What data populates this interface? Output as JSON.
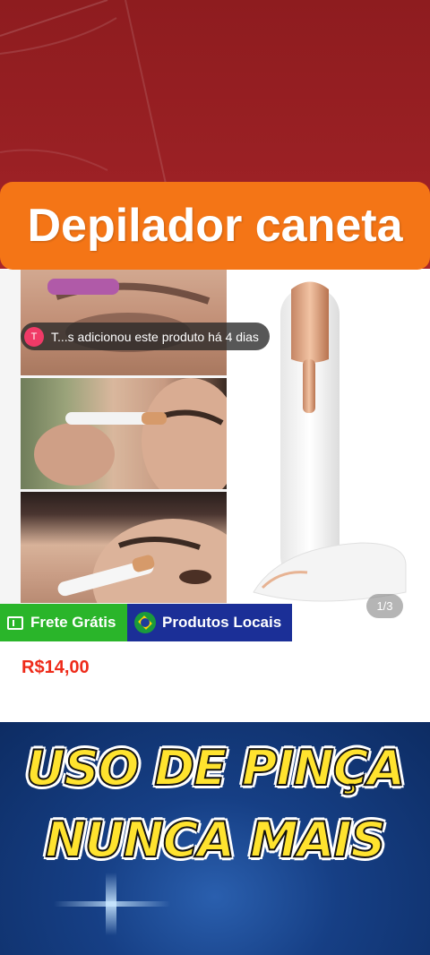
{
  "title": "Depilador caneta",
  "notification": {
    "avatar_letter": "T",
    "text": "T...s adicionou este produto há 4 dias"
  },
  "gallery": {
    "page_indicator": "1/3"
  },
  "badges": {
    "free_shipping": "Frete Grátis",
    "local_products": "Produtos Locais"
  },
  "price": "R$14,00",
  "caption": {
    "line1": "USO DE PINÇA",
    "line2": "NUNCA MAIS"
  },
  "colors": {
    "banner": "#f47516",
    "price": "#ee2b1a",
    "free_shipping": "#2ab52a",
    "local_products": "#1b2f97",
    "caption_text": "#ffe32e"
  }
}
